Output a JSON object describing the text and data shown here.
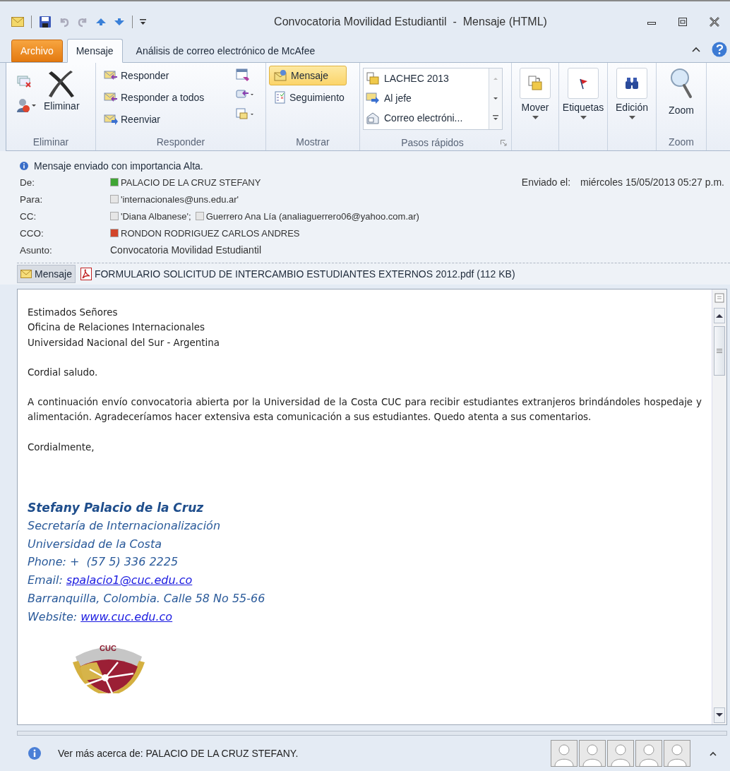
{
  "window": {
    "title": "Convocatoria Movilidad Estudiantil  -  Mensaje (HTML)"
  },
  "tabs": [
    {
      "label": "Archivo",
      "kind": "file",
      "selected": false
    },
    {
      "label": "Mensaje",
      "kind": "tab",
      "selected": true
    },
    {
      "label": "Análisis de correo electrónico de McAfee",
      "kind": "tab",
      "selected": false
    }
  ],
  "ribbon": {
    "delete": {
      "label": "Eliminar",
      "button": "Eliminar"
    },
    "respond": {
      "label": "Responder",
      "buttons": [
        "Responder",
        "Responder a todos",
        "Reenviar"
      ]
    },
    "show": {
      "label": "Mostrar",
      "buttons": [
        {
          "label": "Mensaje",
          "selected": true
        },
        {
          "label": "Seguimiento",
          "selected": false
        }
      ]
    },
    "quick_steps": {
      "label": "Pasos rápidos",
      "items": [
        "LACHEC 2013",
        "Al jefe",
        "Correo electróni..."
      ]
    },
    "large_buttons": [
      {
        "label": "Mover",
        "kind": "move"
      },
      {
        "label": "Etiquetas",
        "kind": "flag"
      },
      {
        "label": "Edición",
        "kind": "find"
      }
    ],
    "zoom": {
      "label": "Zoom",
      "button": "Zoom"
    }
  },
  "info": "Mensaje enviado con importancia Alta.",
  "fields": [
    {
      "label": "De:",
      "kind": "recipients",
      "recipients": [
        {
          "name": "PALACIO DE LA CRUZ STEFANY",
          "color": "#3fa535"
        }
      ]
    },
    {
      "label": "Para:",
      "kind": "recipients",
      "recipients": [
        {
          "name": "'internacionales@uns.edu.ar'",
          "color": "#e6e6e6"
        }
      ]
    },
    {
      "label": "CC:",
      "kind": "recipients",
      "recipients": [
        {
          "name": "'Diana Albanese';",
          "color": "#e6e6e6"
        },
        {
          "name": "Guerrero Ana Lía (analiaguerrero06@yahoo.com.ar)",
          "color": "#e6e6e6"
        }
      ]
    },
    {
      "label": "CCO:",
      "kind": "recipients",
      "recipients": [
        {
          "name": "RONDON RODRIGUEZ CARLOS ANDRES",
          "color": "#d2452a"
        }
      ]
    },
    {
      "label": "Asunto:",
      "kind": "text",
      "value": "Convocatoria Movilidad Estudiantil"
    }
  ],
  "sent": {
    "label": "Enviado el:",
    "value": "miércoles 15/05/2013 05:27 p.m."
  },
  "attachments": [
    {
      "label": "Mensaje",
      "kind": "message",
      "selected": true
    },
    {
      "label": "FORMULARIO SOLICITUD DE INTERCAMBIO ESTUDIANTES EXTERNOS 2012.pdf (112 KB)",
      "kind": "pdf",
      "selected": false
    }
  ],
  "body": {
    "paragraphs": [
      {
        "lines": [
          "Estimados Señores",
          "Oficina de Relaciones Internacionales",
          "Universidad Nacional del Sur - Argentina"
        ]
      },
      {
        "lines": [
          "Cordial saludo."
        ]
      },
      {
        "lines": [
          "A continuación envío convocatoria abierta por la Universidad de la Costa CUC para recibir estudiantes extranjeros brindándoles hospedaje y alimentación. Agradeceríamos hacer extensiva esta comunicación a sus estudiantes. Quedo atenta a sus comentarios."
        ]
      },
      {
        "lines": [
          "Cordialmente,"
        ]
      }
    ],
    "signature": {
      "name": "Stefany Palacio de la Cruz",
      "lines": [
        {
          "text": "Secretaría de Internacionalización"
        },
        {
          "text": "Universidad de la Costa"
        },
        {
          "text": "Phone: +  (57 5) 336 2225"
        },
        {
          "text": "Email: ",
          "link": "spalacio1@cuc.edu.co"
        },
        {
          "text": "Barranquilla, Colombia. Calle 58 No 55-66"
        },
        {
          "text": "Website: ",
          "link": "www.cuc.edu.co"
        }
      ]
    },
    "logo": {
      "text": "CUC"
    }
  },
  "people_pane": {
    "text": "Ver más acerca de: PALACIO DE LA CRUZ STEFANY."
  }
}
